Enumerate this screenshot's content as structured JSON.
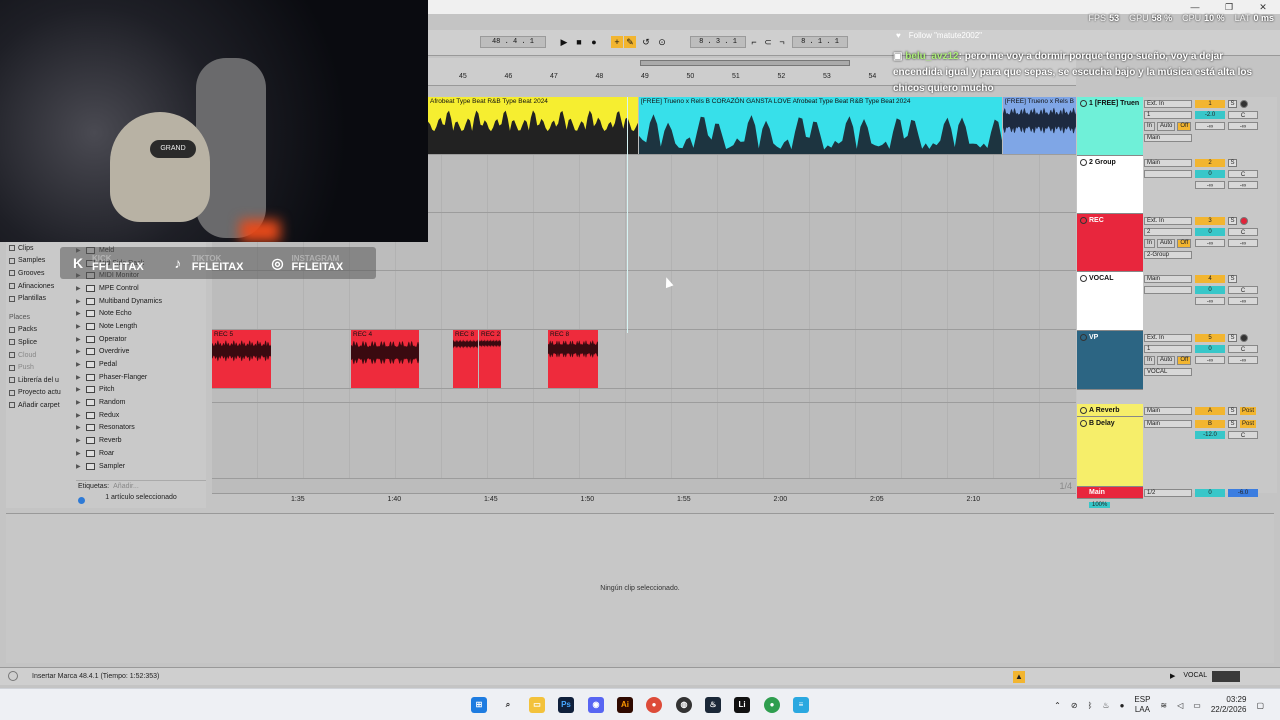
{
  "window": {
    "minimize": "—",
    "restore": "❐",
    "close": "✕"
  },
  "stats": [
    {
      "label": "FPS",
      "value": "53"
    },
    {
      "label": "GPU",
      "value": "58 %"
    },
    {
      "label": "CPU",
      "value": "10 %"
    },
    {
      "label": "LAT",
      "value": "0 ms"
    }
  ],
  "transport": {
    "position": "48 .  4 .  1",
    "loop_start": "8 .  3 .  1",
    "loop_length": "8 .  1 .  1"
  },
  "chat": {
    "follow": "Follow \"matute2002\"",
    "user": "belu_avz12",
    "message": ": pero me voy a dormir porque tengo sueño, voy a dejar encendida igual y para que sepas, se escucha bajo y la música está alta los chicos quiero mucho"
  },
  "social": [
    {
      "icon": "K",
      "small": "KICK",
      "handle": "FFLEITAX"
    },
    {
      "icon": "♪",
      "small": "TIKTOK",
      "handle": "FFLEITAX"
    },
    {
      "icon": "◎",
      "small": "INSTAGRAM",
      "handle": "FFLEITAX"
    }
  ],
  "cam": {
    "hat_text": "GRAND"
  },
  "browser": {
    "categories": [
      "Clips",
      "Samples",
      "Grooves",
      "Afinaciones",
      "Plantillas"
    ],
    "places_header": "Places",
    "places": [
      {
        "label": "Packs",
        "muted": false
      },
      {
        "label": "Splice",
        "muted": false
      },
      {
        "label": "Cloud",
        "muted": true
      },
      {
        "label": "Push",
        "muted": true
      },
      {
        "label": "Librería del u",
        "muted": false
      },
      {
        "label": "Proyecto actu",
        "muted": false
      },
      {
        "label": "Añadir carpet",
        "muted": false
      }
    ],
    "devices": [
      "Meld",
      "Mid Side Rack",
      "MIDI Monitor",
      "MPE Control",
      "Multiband Dynamics",
      "Note Echo",
      "Note Length",
      "Operator",
      "Overdrive",
      "Pedal",
      "Phaser-Flanger",
      "Pitch",
      "Random",
      "Redux",
      "Resonators",
      "Reverb",
      "Roar",
      "Sampler"
    ],
    "tags_label": "Etiquetas:",
    "tags_placeholder": "Añadir...",
    "selection": "1 artículo seleccionado"
  },
  "arrangement": {
    "bars": [
      "45",
      "46",
      "47",
      "48",
      "49",
      "50",
      "51",
      "52",
      "53",
      "54"
    ],
    "times": [
      "1:35",
      "1:40",
      "1:45",
      "1:50",
      "1:55",
      "2:00",
      "2:05",
      "2:10"
    ],
    "clips": {
      "yellow": "Afrobeat Type Beat  R&B  Type Beat 2024",
      "cyan": "[FREE] Trueno x Rels B CORAZÓN GANSTA LOVE Afrobeat Type Beat  R&B  Type Beat 2024",
      "blue": "[FREE] Trueno x Rels B",
      "rec": [
        "REC 5",
        "REC 4",
        "REC 8",
        "REC 2",
        "REC 8"
      ]
    },
    "page_indicator": "1/4"
  },
  "mixer": {
    "tracks": [
      {
        "name": "1 [FREE] Truen",
        "color": "#6ff0d8",
        "input": "Ext. In",
        "channel": "1",
        "output": "Main",
        "num": "1",
        "vol": "-2.0",
        "pan": "C"
      },
      {
        "name": "2 Group",
        "color": "#ffffff",
        "input": "Main",
        "channel": "",
        "output": "",
        "num": "2",
        "vol": "0",
        "pan": "C"
      },
      {
        "name": "REC",
        "color": "#e8263d",
        "input": "Ext. In",
        "channel": "2",
        "output": "2-Group",
        "num": "3",
        "vol": "0",
        "pan": "C"
      },
      {
        "name": "VOCAL",
        "color": "#ffffff",
        "input": "Main",
        "channel": "",
        "output": "",
        "num": "4",
        "vol": "0",
        "pan": "C"
      },
      {
        "name": "VP",
        "color": "#2c6583",
        "input": "Ext. In",
        "channel": "1",
        "output": "VOCAL",
        "num": "5",
        "vol": "0",
        "pan": "C"
      }
    ],
    "returns": [
      {
        "name": "A Reverb",
        "output": "Main",
        "num": "A",
        "post": "Post"
      },
      {
        "name": "B Delay",
        "output": "Main",
        "num": "B",
        "post": "Post",
        "vol": "-12.0",
        "pan": "C"
      }
    ],
    "master": {
      "name": "Main",
      "output": "1/2",
      "vol": "0",
      "level": "-6.0",
      "zoom": "100%"
    },
    "labels": {
      "in": "In",
      "auto": "Auto",
      "off": "Off",
      "inf": "-∞",
      "solo": "S",
      "c": "C"
    }
  },
  "detail": {
    "empty": "Ningún clip seleccionado."
  },
  "status": {
    "text": "Insertar Marca 48.4.1 (Tiempo: 1:52:353)",
    "track": "VOCAL"
  },
  "taskbar": {
    "lang": "ESP",
    "lang2": "LAA",
    "time": "03:29",
    "date": "22/2/2026"
  },
  "colors": {
    "yellow_clip": "#f6ee30",
    "cyan_clip": "#37e0ea",
    "blue_clip": "#7fa6e6",
    "rec_clip": "#ee2b3c"
  }
}
